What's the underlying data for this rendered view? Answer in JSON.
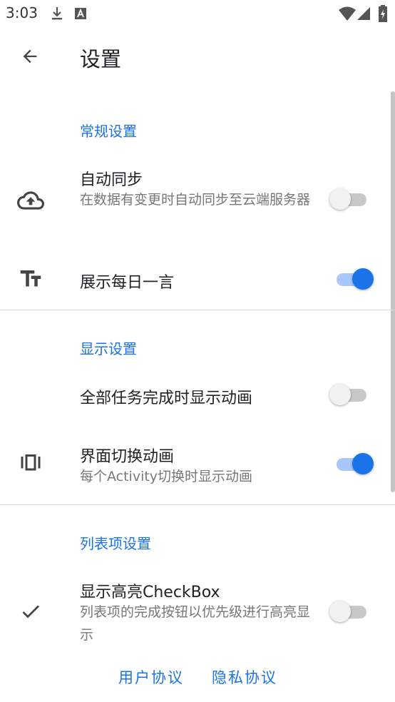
{
  "status_bar": {
    "time": "3:03",
    "icons": [
      "download-icon",
      "font-notification-icon",
      "wifi-icon",
      "signal-icon",
      "battery-icon"
    ]
  },
  "app_bar": {
    "back_icon": "arrow-back-icon",
    "title": "设置"
  },
  "sections": {
    "general": {
      "header": "常规设置",
      "auto_sync": {
        "icon": "cloud-upload-icon",
        "title": "自动同步",
        "summary": "在数据有变更时自动同步至云端服务器",
        "enabled": false
      },
      "daily_quote": {
        "icon": "text-fields-icon",
        "title": "展示每日一言",
        "enabled": true
      }
    },
    "display": {
      "header": "显示设置",
      "done_animation": {
        "title": "全部任务完成时显示动画",
        "enabled": false
      },
      "transition_animation": {
        "icon": "view-carousel-icon",
        "title": "界面切换动画",
        "summary": "每个Activity切换时显示动画",
        "enabled": true
      }
    },
    "list": {
      "header": "列表项设置",
      "highlight_checkbox": {
        "icon": "check-icon",
        "title": "显示高亮CheckBox",
        "summary": "列表项的完成按钮以优先级进行高亮显示",
        "enabled": false
      }
    }
  },
  "footer": {
    "user_agreement": "用户协议",
    "privacy_policy": "隐私协议"
  },
  "colors": {
    "accent": "#1a73e8",
    "switch_on_track": "#a8c7fa",
    "switch_off_track": "#c8c8c8",
    "summary_text": "#777777"
  }
}
